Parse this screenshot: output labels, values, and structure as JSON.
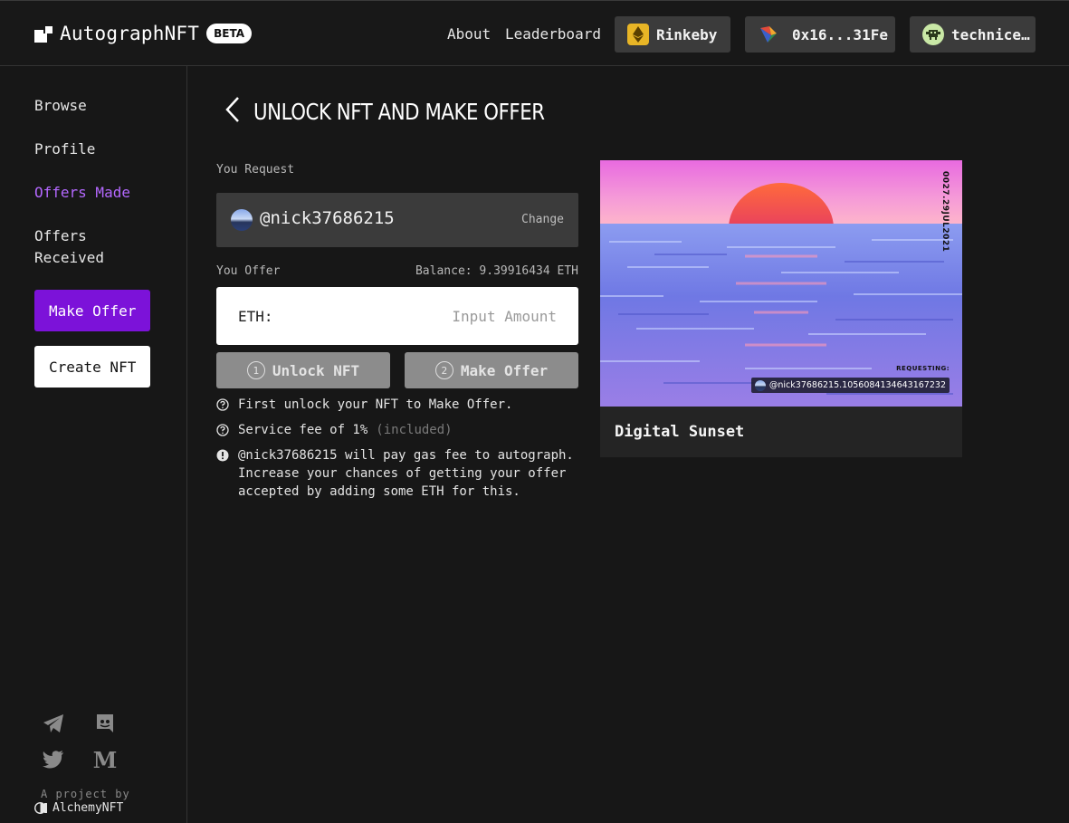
{
  "header": {
    "brand": "AutographNFT",
    "badge": "BETA",
    "nav": [
      "About",
      "Leaderboard"
    ],
    "network": "Rinkeby",
    "wallet_address": "0x16...31Fe",
    "username": "technice…"
  },
  "sidebar": {
    "items": [
      {
        "label": "Browse",
        "active": false
      },
      {
        "label": "Profile",
        "active": false
      },
      {
        "label": "Offers Made",
        "active": true
      },
      {
        "label": "Offers Received",
        "active": false
      }
    ],
    "make_offer_button": "Make Offer",
    "create_nft_button": "Create NFT",
    "social_icons": [
      "telegram-icon",
      "discord-icon",
      "twitter-icon",
      "medium-icon"
    ],
    "project_by": "A project by",
    "project_name": "AlchemyNFT"
  },
  "main": {
    "title": "UNLOCK NFT AND MAKE OFFER",
    "you_request_label": "You Request",
    "requested_handle": "@nick37686215",
    "change_label": "Change",
    "you_offer_label": "You Offer",
    "balance": "Balance: 9.39916434 ETH",
    "currency_label": "ETH:",
    "amount_placeholder": "Input Amount",
    "steps": [
      {
        "number": "1",
        "label": "Unlock NFT"
      },
      {
        "number": "2",
        "label": "Make Offer"
      }
    ],
    "info": {
      "unlock_note": "First unlock your NFT to Make Offer.",
      "fee_note": "Service fee of 1%",
      "fee_included": "(included)",
      "gas_note": "@nick37686215 will pay gas fee to autograph. Increase your chances of getting your offer accepted by adding some ETH for this."
    }
  },
  "card": {
    "title": "Digital Sunset",
    "date_stamp": "0027.29JUL2021",
    "requesting_label": "REQUESTING:",
    "requesting_tag": "@nick37686215.1056084134643167232"
  },
  "colors": {
    "accent": "#7c12d9",
    "active_link": "#b468ff",
    "background": "#171717"
  }
}
